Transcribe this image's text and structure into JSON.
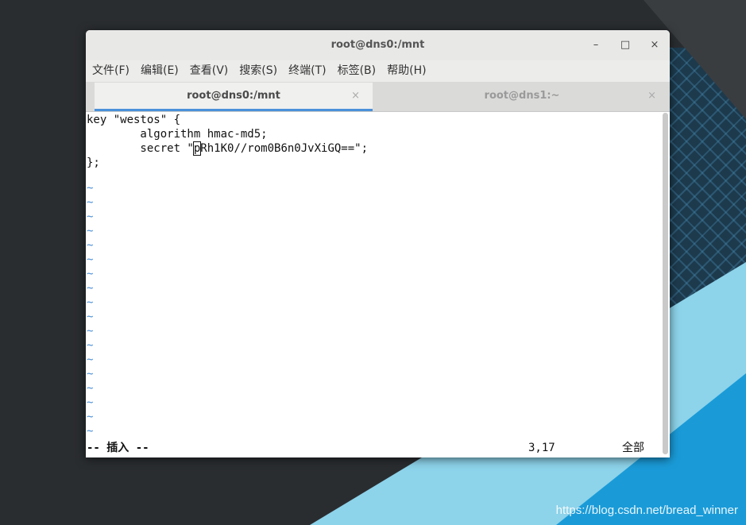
{
  "window": {
    "title": "root@dns0:/mnt",
    "controls": {
      "minimize": "–",
      "maximize": "□",
      "close": "×"
    }
  },
  "menu": [
    "文件(F)",
    "编辑(E)",
    "查看(V)",
    "搜索(S)",
    "终端(T)",
    "标签(B)",
    "帮助(H)"
  ],
  "tabs": [
    {
      "label": "root@dns0:/mnt",
      "active": true,
      "close": "×"
    },
    {
      "label": "root@dns1:~",
      "active": false,
      "close": "×"
    }
  ],
  "editor": {
    "lines": [
      "key \"westos\" {",
      "        algorithm hmac-md5;",
      "        secret \"",
      "};"
    ],
    "cursor_char": "p",
    "secret_rest": "Rh1K0//rom0B6n0JvXiGQ==\";",
    "tilde": "~",
    "tilde_count": 18,
    "status_mode": "-- 插入 --",
    "cursor_pos": "3,17",
    "scroll_pct": "全部"
  },
  "watermark": "https://blog.csdn.net/bread_winner",
  "colors": {
    "accent": "#4a90d9",
    "tilde": "#4a8fd6",
    "stripe_light": "#8dd3ea",
    "stripe_dark": "#1a9bd8"
  }
}
